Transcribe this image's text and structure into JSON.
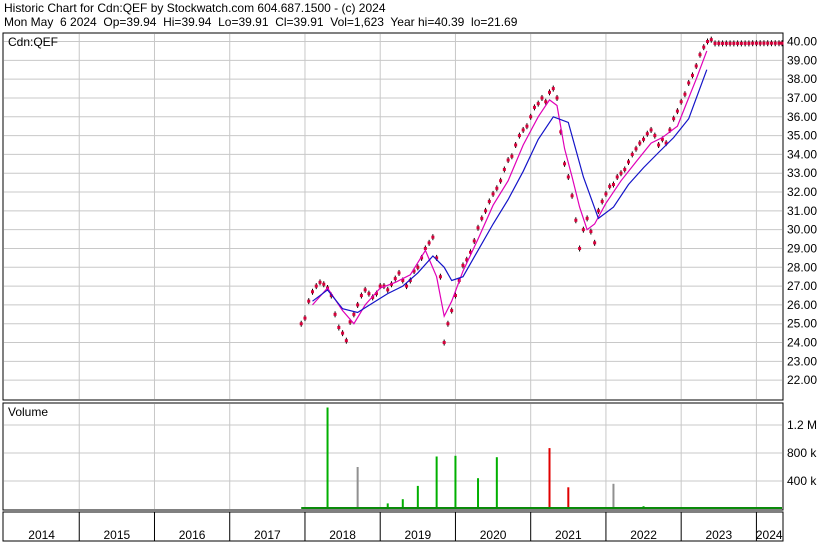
{
  "header": {
    "line1": "Historic Chart for Cdn:QEF by Stockwatch.com 604.687.1500 - (c) 2024",
    "line2": "Mon May  6 2024  Op=39.94  Hi=39.94  Lo=39.91  Cl=39.91  Vol=1,623  Year hi=40.39  lo=21.69"
  },
  "chart_data": [
    {
      "type": "line",
      "panel": "price",
      "title": "Cdn:QEF",
      "yticks": [
        "22.00",
        "23.00",
        "24.00",
        "25.00",
        "26.00",
        "27.00",
        "28.00",
        "29.00",
        "30.00",
        "31.00",
        "32.00",
        "33.00",
        "34.00",
        "35.00",
        "36.00",
        "37.00",
        "38.00",
        "39.00",
        "40.00"
      ],
      "ylim": [
        21.0,
        40.4
      ],
      "xlim": [
        2014.0,
        2024.34
      ],
      "grid": true,
      "series": [
        {
          "color": "#d4003a",
          "style": "daily-points",
          "x": [
            2017.95,
            2018.0,
            2018.05,
            2018.1,
            2018.15,
            2018.2,
            2018.25,
            2018.3,
            2018.35,
            2018.4,
            2018.45,
            2018.5,
            2018.55,
            2018.6,
            2018.65,
            2018.7,
            2018.75,
            2018.8,
            2018.85,
            2018.9,
            2018.95,
            2019.0,
            2019.05,
            2019.1,
            2019.15,
            2019.2,
            2019.25,
            2019.3,
            2019.35,
            2019.4,
            2019.45,
            2019.5,
            2019.55,
            2019.6,
            2019.65,
            2019.7,
            2019.75,
            2019.8,
            2019.85,
            2019.9,
            2019.95,
            2020.0,
            2020.05,
            2020.1,
            2020.15,
            2020.2,
            2020.25,
            2020.3,
            2020.35,
            2020.4,
            2020.45,
            2020.5,
            2020.55,
            2020.6,
            2020.65,
            2020.7,
            2020.75,
            2020.8,
            2020.85,
            2020.9,
            2020.95,
            2021.0,
            2021.05,
            2021.1,
            2021.15,
            2021.2,
            2021.25,
            2021.3,
            2021.35,
            2021.4,
            2021.45,
            2021.5,
            2021.55,
            2021.6,
            2021.65,
            2021.7,
            2021.75,
            2021.8,
            2021.85,
            2021.9,
            2021.95,
            2022.0,
            2022.05,
            2022.1,
            2022.15,
            2022.2,
            2022.25,
            2022.3,
            2022.35,
            2022.4,
            2022.45,
            2022.5,
            2022.55,
            2022.6,
            2022.65,
            2022.7,
            2022.75,
            2022.8,
            2022.85,
            2022.9,
            2022.95,
            2023.0,
            2023.05,
            2023.1,
            2023.15,
            2023.2,
            2023.25,
            2023.3,
            2023.35,
            2023.4,
            2023.45,
            2023.5,
            2023.55,
            2023.6,
            2023.65,
            2023.7,
            2023.75,
            2023.8,
            2023.85,
            2023.9,
            2023.95,
            2024.0,
            2024.05,
            2024.1,
            2024.15,
            2024.2,
            2024.25,
            2024.3,
            2024.34
          ],
          "y": [
            25.0,
            25.3,
            26.2,
            26.7,
            27.0,
            27.2,
            27.1,
            26.9,
            26.5,
            25.5,
            24.8,
            24.5,
            24.1,
            25.1,
            25.5,
            26.0,
            26.5,
            26.8,
            26.6,
            26.4,
            26.6,
            27.0,
            27.0,
            26.8,
            27.1,
            27.4,
            27.7,
            27.3,
            27.0,
            27.3,
            27.8,
            28.0,
            28.5,
            29.0,
            29.3,
            29.6,
            28.5,
            27.5,
            24.0,
            25.0,
            25.7,
            26.5,
            27.3,
            28.1,
            28.4,
            28.8,
            29.4,
            30.1,
            30.6,
            31.0,
            31.5,
            31.9,
            32.2,
            32.6,
            33.2,
            33.7,
            33.9,
            34.5,
            35.0,
            35.3,
            35.5,
            36.0,
            36.5,
            36.7,
            37.0,
            36.8,
            37.3,
            37.5,
            37.0,
            35.2,
            33.5,
            32.8,
            31.8,
            30.5,
            29.0,
            30.0,
            30.6,
            29.9,
            29.3,
            31.0,
            31.5,
            31.9,
            32.3,
            32.4,
            32.8,
            33.0,
            33.2,
            33.6,
            34.0,
            34.3,
            34.6,
            34.8,
            35.1,
            35.3,
            35.0,
            34.5,
            34.8,
            34.6,
            35.3,
            35.9,
            36.3,
            36.8,
            37.2,
            37.8,
            38.2,
            38.7,
            39.3,
            39.7,
            40.0,
            40.1,
            39.9,
            39.9,
            39.9,
            39.9,
            39.9,
            39.9,
            39.9,
            39.9,
            39.9,
            39.9,
            39.91,
            39.91,
            39.91,
            39.91,
            39.91,
            39.91,
            39.91,
            39.91,
            39.91
          ]
        },
        {
          "color": "#e000b8",
          "style": "moving-average-short",
          "x": [
            2018.1,
            2018.3,
            2018.5,
            2018.65,
            2018.8,
            2019.0,
            2019.2,
            2019.4,
            2019.6,
            2019.75,
            2019.85,
            2019.95,
            2020.1,
            2020.3,
            2020.5,
            2020.7,
            2020.9,
            2021.1,
            2021.25,
            2021.35,
            2021.45,
            2021.55,
            2021.65,
            2021.75,
            2021.85,
            2022.0,
            2022.2,
            2022.4,
            2022.6,
            2022.75,
            2022.85,
            2022.95,
            2023.05,
            2023.2,
            2023.34
          ],
          "y": [
            26.0,
            26.9,
            25.7,
            25.0,
            26.0,
            26.9,
            27.2,
            27.6,
            28.9,
            27.5,
            25.4,
            26.2,
            27.8,
            29.5,
            31.3,
            32.6,
            34.5,
            36.0,
            36.9,
            36.6,
            34.3,
            32.8,
            31.2,
            30.0,
            30.3,
            31.4,
            32.6,
            33.6,
            34.6,
            34.9,
            35.2,
            35.5,
            36.5,
            38.0,
            39.5
          ]
        },
        {
          "color": "#1414c8",
          "style": "moving-average-long",
          "x": [
            2018.1,
            2018.3,
            2018.5,
            2018.7,
            2018.9,
            2019.1,
            2019.3,
            2019.5,
            2019.7,
            2019.85,
            2019.95,
            2020.1,
            2020.3,
            2020.5,
            2020.7,
            2020.9,
            2021.1,
            2021.3,
            2021.5,
            2021.7,
            2021.9,
            2022.1,
            2022.3,
            2022.5,
            2022.7,
            2022.9,
            2023.1,
            2023.34
          ],
          "y": [
            26.2,
            26.8,
            25.8,
            25.6,
            26.1,
            26.6,
            27.0,
            27.7,
            28.6,
            28.0,
            27.3,
            27.5,
            28.9,
            30.3,
            31.6,
            33.1,
            34.8,
            36.0,
            35.7,
            32.8,
            30.6,
            31.2,
            32.4,
            33.3,
            34.1,
            34.9,
            35.9,
            38.5
          ]
        }
      ]
    },
    {
      "type": "bar",
      "panel": "volume",
      "title": "Volume",
      "yticks": [
        "400 k",
        "800 k",
        "1.2 M"
      ],
      "ylim": [
        0,
        1500000
      ],
      "grid": true,
      "series": [
        {
          "name": "",
          "x": [
            2018.3,
            2018.7,
            2019.1,
            2019.3,
            2019.5,
            2019.75,
            2020.0,
            2020.3,
            2020.55,
            2021.25,
            2021.5,
            2022.1,
            2022.5
          ],
          "values": [
            1450000,
            600000,
            80000,
            140000,
            330000,
            750000,
            760000,
            440000,
            740000,
            870000,
            310000,
            360000,
            40000
          ],
          "colors": [
            "#00b000",
            "#909090",
            "#00b000",
            "#00b000",
            "#00b000",
            "#00b000",
            "#00b000",
            "#00b000",
            "#00b000",
            "#e00000",
            "#e00000",
            "#909090",
            "#00b000"
          ]
        }
      ]
    },
    {
      "type": "line",
      "panel": "x-axis",
      "years": [
        "2014",
        "2015",
        "2016",
        "2017",
        "2018",
        "2019",
        "2020",
        "2021",
        "2022",
        "2023",
        "2024"
      ]
    }
  ]
}
